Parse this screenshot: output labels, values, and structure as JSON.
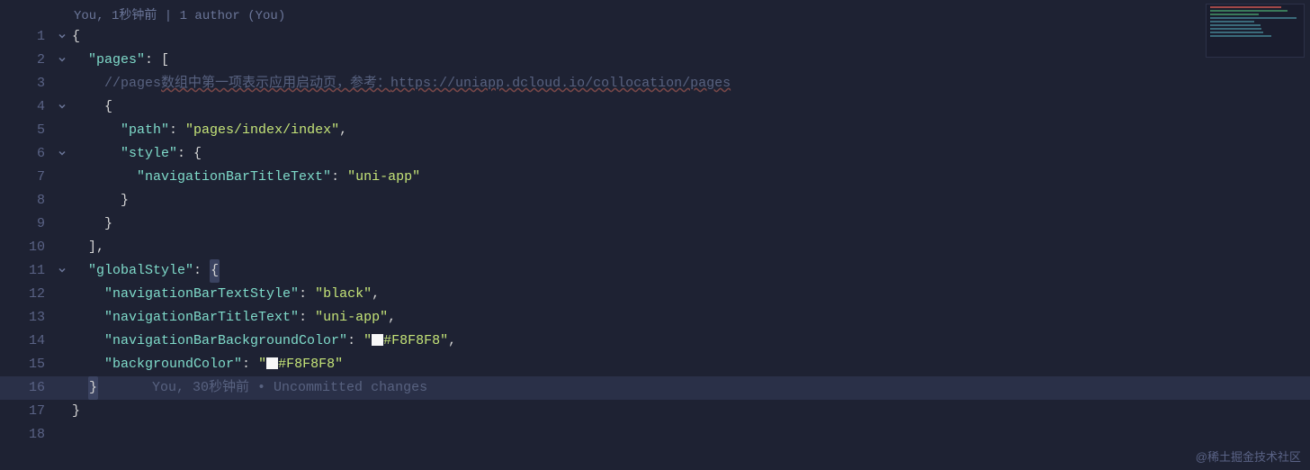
{
  "blame_header": "You, 1秒钟前 | 1 author (You)",
  "lines": [
    {
      "num": 1,
      "fold": true,
      "indent": 0,
      "tokens": [
        [
          "brace",
          "{"
        ]
      ]
    },
    {
      "num": 2,
      "fold": true,
      "indent": 1,
      "tokens": [
        [
          "key",
          "\"pages\""
        ],
        [
          "punc",
          ": ["
        ]
      ]
    },
    {
      "num": 3,
      "fold": false,
      "indent": 2,
      "tokens": [
        [
          "comment",
          "//pages"
        ],
        [
          "comment-cn",
          "数组中第一项表示应用启动页，参考："
        ],
        [
          "comment-link",
          "https://uniapp.dcloud.io/collocation/pages"
        ]
      ]
    },
    {
      "num": 4,
      "fold": true,
      "indent": 2,
      "tokens": [
        [
          "brace",
          "{"
        ]
      ]
    },
    {
      "num": 5,
      "fold": false,
      "indent": 3,
      "tokens": [
        [
          "key",
          "\"path\""
        ],
        [
          "punc",
          ": "
        ],
        [
          "string",
          "\"pages/index/index\""
        ],
        [
          "punc",
          ","
        ]
      ]
    },
    {
      "num": 6,
      "fold": true,
      "indent": 3,
      "tokens": [
        [
          "key",
          "\"style\""
        ],
        [
          "punc",
          ": "
        ],
        [
          "brace",
          "{"
        ]
      ]
    },
    {
      "num": 7,
      "fold": false,
      "indent": 4,
      "tokens": [
        [
          "key",
          "\"navigationBarTitleText\""
        ],
        [
          "punc",
          ": "
        ],
        [
          "string",
          "\"uni-app\""
        ]
      ]
    },
    {
      "num": 8,
      "fold": false,
      "indent": 3,
      "tokens": [
        [
          "brace",
          "}"
        ]
      ]
    },
    {
      "num": 9,
      "fold": false,
      "indent": 2,
      "tokens": [
        [
          "brace",
          "}"
        ]
      ]
    },
    {
      "num": 10,
      "fold": false,
      "indent": 1,
      "tokens": [
        [
          "punc",
          "],"
        ]
      ]
    },
    {
      "num": 11,
      "fold": true,
      "indent": 1,
      "tokens": [
        [
          "key",
          "\"globalStyle\""
        ],
        [
          "punc",
          ": "
        ],
        [
          "brace-hl",
          "{"
        ]
      ]
    },
    {
      "num": 12,
      "fold": false,
      "indent": 2,
      "tokens": [
        [
          "key",
          "\"navigationBarTextStyle\""
        ],
        [
          "punc",
          ": "
        ],
        [
          "string",
          "\"black\""
        ],
        [
          "punc",
          ","
        ]
      ]
    },
    {
      "num": 13,
      "fold": false,
      "indent": 2,
      "tokens": [
        [
          "key",
          "\"navigationBarTitleText\""
        ],
        [
          "punc",
          ": "
        ],
        [
          "string",
          "\"uni-app\""
        ],
        [
          "punc",
          ","
        ]
      ]
    },
    {
      "num": 14,
      "fold": false,
      "indent": 2,
      "tokens": [
        [
          "key",
          "\"navigationBarBackgroundColor\""
        ],
        [
          "punc",
          ": "
        ],
        [
          "string",
          "\""
        ],
        [
          "swatch",
          ""
        ],
        [
          "string",
          "#F8F8F8\""
        ],
        [
          "punc",
          ","
        ]
      ]
    },
    {
      "num": 15,
      "fold": false,
      "indent": 2,
      "tokens": [
        [
          "key",
          "\"backgroundColor\""
        ],
        [
          "punc",
          ": "
        ],
        [
          "string",
          "\""
        ],
        [
          "swatch",
          ""
        ],
        [
          "string",
          "#F8F8F8\""
        ]
      ]
    },
    {
      "num": 16,
      "fold": false,
      "indent": 1,
      "hl": true,
      "tokens": [
        [
          "brace-hl",
          "}"
        ]
      ],
      "inline_git": "You, 30秒钟前 • Uncommitted changes"
    },
    {
      "num": 17,
      "fold": false,
      "indent": 0,
      "tokens": [
        [
          "brace",
          "}"
        ]
      ]
    },
    {
      "num": 18,
      "fold": false,
      "indent": 0,
      "tokens": []
    }
  ],
  "minimap_colors": [
    "#a04848",
    "#3a7a5a",
    "#3a7a5a",
    "#3a6a7a",
    "#3a6a7a",
    "#3a6a7a",
    "#3a6a7a",
    "#3a6a7a",
    "#3a6a7a"
  ],
  "swatch_color": "#F8F8F8",
  "indent_unit": "  ",
  "watermark": "@稀土掘金技术社区"
}
